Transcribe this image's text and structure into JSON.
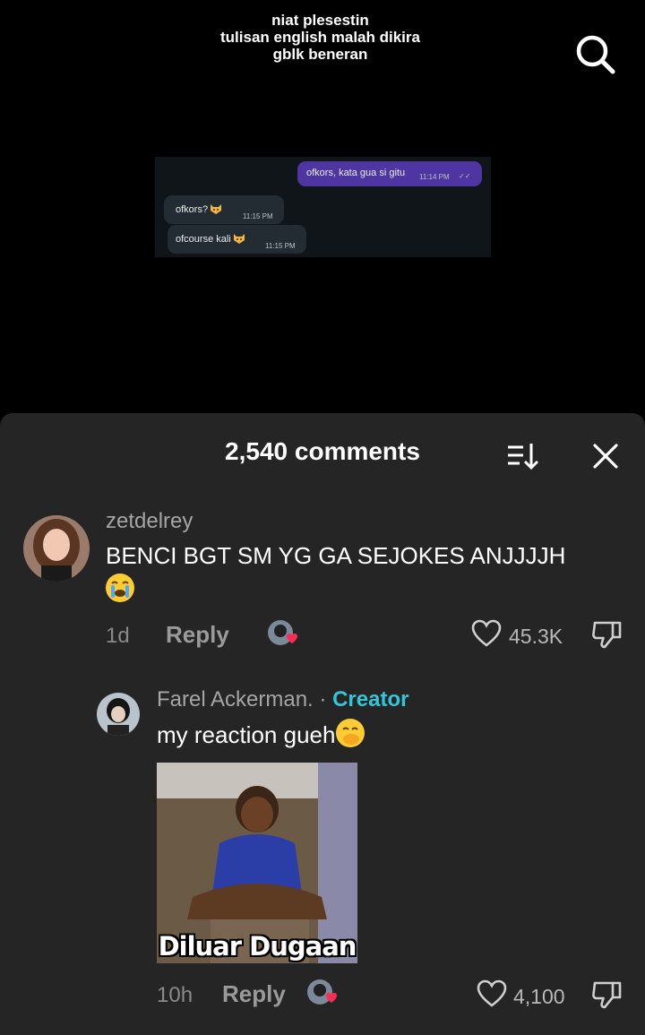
{
  "video": {
    "caption_lines": [
      "niat plesestin",
      "tulisan english malah dikira",
      "gblk beneran"
    ],
    "chat": {
      "outgoing": {
        "text": "ofkors, kata gua si gitu",
        "time": "11:14 PM",
        "ticks": "✓✓"
      },
      "incoming": [
        {
          "text": "ofkors?",
          "time": "11:15 PM"
        },
        {
          "text": "ofcourse kali",
          "time": "11:15 PM"
        }
      ]
    }
  },
  "sheet": {
    "title": "2,540 comments",
    "comments": [
      {
        "username": "zetdelrey",
        "text": "BENCI BGT SM YG GA SEJOKES ANJJJJH",
        "age": "1d",
        "reply_label": "Reply",
        "likes": "45.3K"
      },
      {
        "username": "Farel Ackerman.",
        "separator": "·",
        "creator_label": "Creator",
        "text": "my reaction gueh",
        "image_caption": "Diluar Dugaan",
        "age": "10h",
        "reply_label": "Reply",
        "likes": "4,100"
      }
    ]
  },
  "colors": {
    "sheet_bg": "#252525",
    "creator": "#34c6d8",
    "outgoing_bubble": "#4e35a1",
    "incoming_bubble": "#222c32"
  }
}
